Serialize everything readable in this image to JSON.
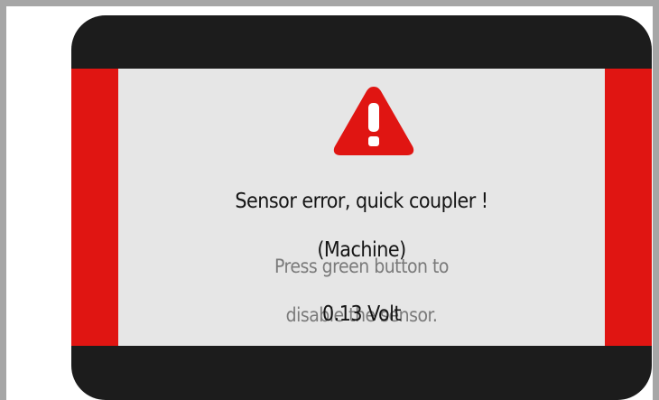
{
  "error": {
    "title_line1": "Sensor error, quick coupler !",
    "title_line2": "(Machine)",
    "instruction_line1": "Press green button to",
    "instruction_line2": "disable the sensor.",
    "voltage": "0.13 Volt"
  },
  "icons": {
    "warning": "warning-triangle-icon"
  },
  "colors": {
    "accent_red": "#e01512",
    "panel_background": "#e6e6e6",
    "screen_bezel": "#1c1c1c",
    "frame": "#a6a6a6",
    "primary_text": "#141414",
    "secondary_text": "#7a7a7a"
  }
}
